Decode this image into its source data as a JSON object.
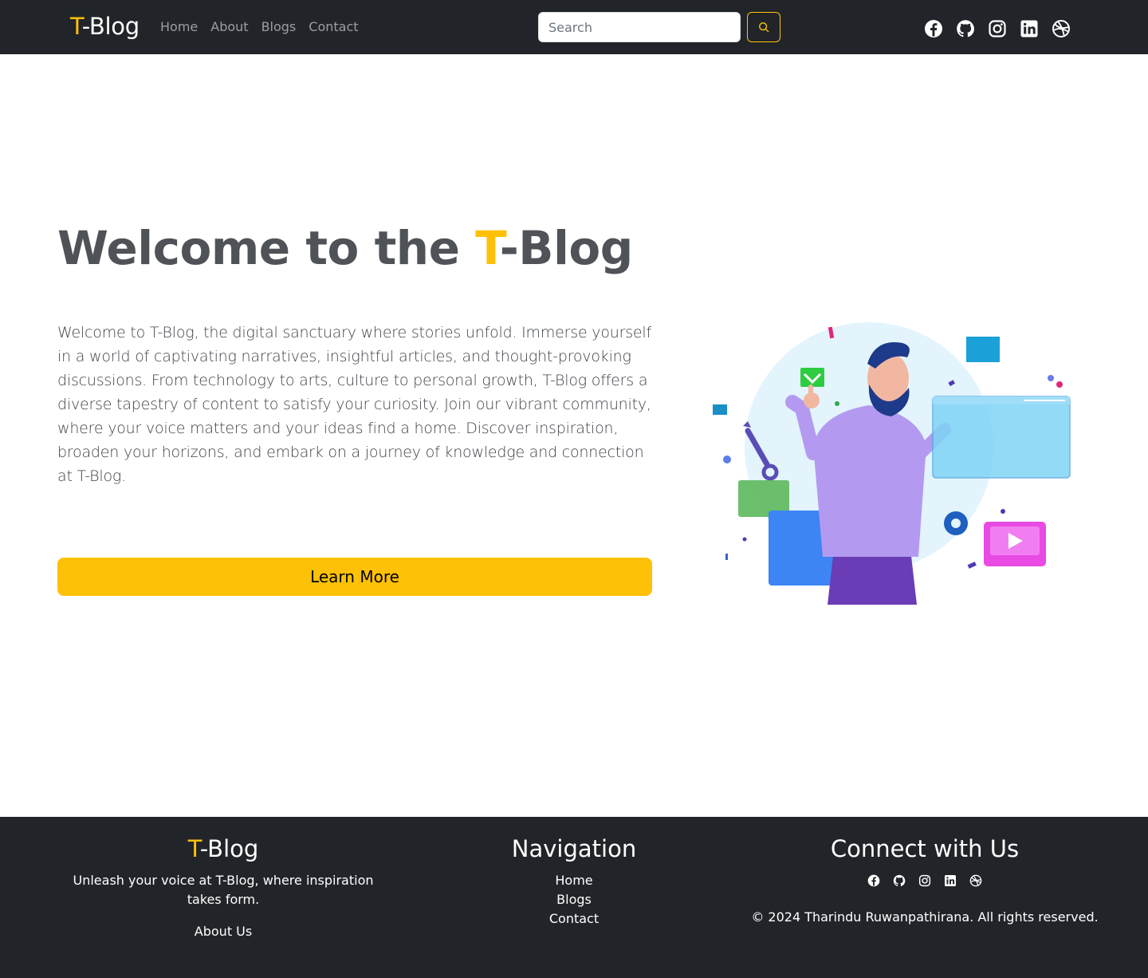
{
  "navbar": {
    "brand_accent": "T",
    "brand_rest": "-Blog",
    "links": [
      "Home",
      "About",
      "Blogs",
      "Contact"
    ],
    "search_placeholder": "Search",
    "social_icons": [
      "facebook-icon",
      "github-icon",
      "instagram-icon",
      "linkedin-icon",
      "dribbble-icon"
    ]
  },
  "hero": {
    "title_prefix": "Welcome to the ",
    "title_accent": "T",
    "title_suffix": "-Blog",
    "description": "Welcome to T-Blog, the digital sanctuary where stories unfold. Immerse yourself in a world of captivating narratives, insightful articles, and thought-provoking discussions. From technology to arts, culture to personal growth, T-Blog offers a diverse tapestry of content to satisfy your curiosity. Join our vibrant community, where your voice matters and your ideas find a home. Discover inspiration, broaden your horizons, and embark on a journey of knowledge and connection at T-Blog.",
    "cta_label": "Learn More"
  },
  "footer": {
    "brand_accent": "T",
    "brand_rest": "-Blog",
    "tagline": "Unleash your voice at T-Blog, where inspiration takes form.",
    "about_link": "About Us",
    "nav_heading": "Navigation",
    "nav_links": [
      "Home",
      "Blogs",
      "Contact"
    ],
    "connect_heading": "Connect with Us",
    "copyright": "© 2024 Tharindu Ruwanpathirana. All rights reserved."
  },
  "colors": {
    "accent": "#ffc107",
    "dark": "#212529",
    "title_gray": "#4f5257"
  }
}
